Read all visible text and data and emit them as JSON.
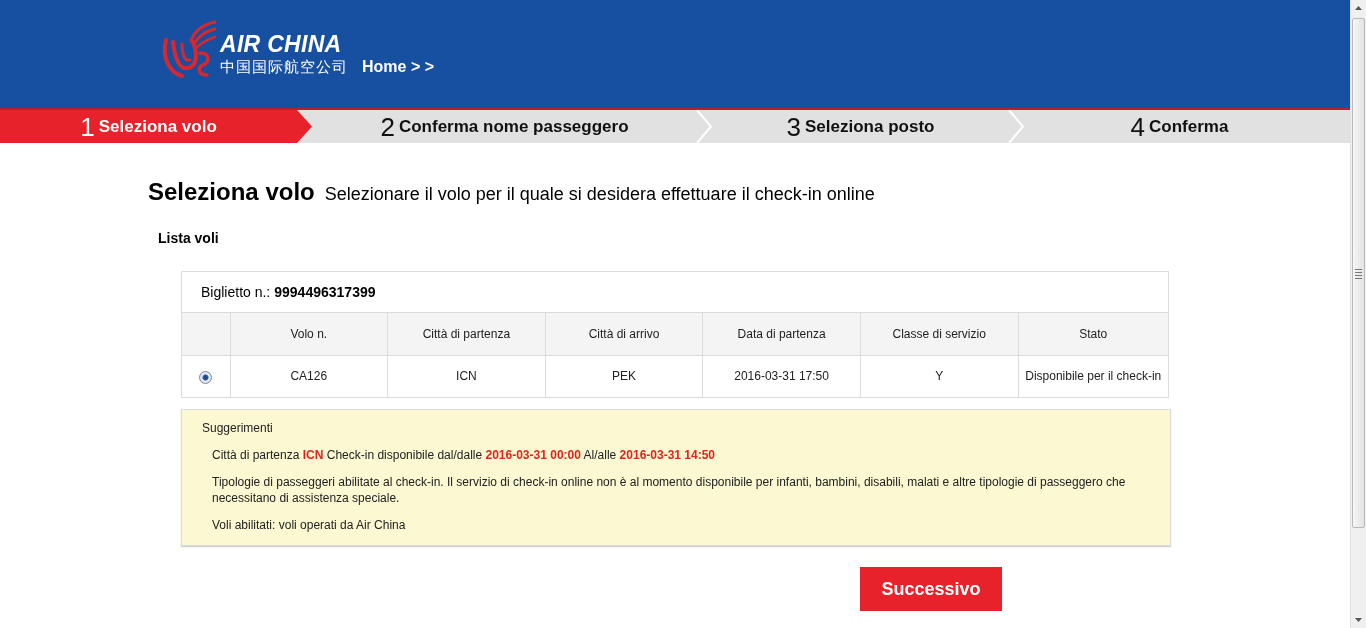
{
  "header": {
    "logo_text": "AIR CHINA",
    "logo_text_cn": "中国国际航空公司",
    "breadcrumb": "Home > >"
  },
  "steps": [
    {
      "number": "1",
      "label": "Seleziona volo",
      "selected": true
    },
    {
      "number": "2",
      "label": "Conferma nome passeggero",
      "selected": false
    },
    {
      "number": "3",
      "label": "Seleziona posto",
      "selected": false
    },
    {
      "number": "4",
      "label": "Conferma",
      "selected": false
    }
  ],
  "page": {
    "title": "Seleziona volo",
    "subtitle": "Selezionare il volo per il quale si desidera effettuare il check-in online"
  },
  "flight_list": {
    "heading": "Lista voli",
    "ticket_label": "Biglietto n.:",
    "ticket_number": "9994496317399",
    "columns": [
      "Volo n.",
      "Città di partenza",
      "Città di arrivo",
      "Data di partenza",
      "Classe di servizio",
      "Stato"
    ],
    "rows": [
      {
        "selected": true,
        "cells": [
          "CA126",
          "ICN",
          "PEK",
          "2016-03-31 17:50",
          "Y",
          "Disponibile per il check-in"
        ]
      }
    ]
  },
  "tips": {
    "title": "Suggerimenti",
    "items": [
      "Città di partenza **ICN** Check-in disponibile dal/dalle **2016-03-31 00:00** Al/alle **2016-03-31 14:50**",
      "Tipologie di passeggeri abilitate al check-in. Il servizio di check-in online non è al momento disponibile per infanti, bambini, disabili, malati e altre tipologie di passeggero che necessitano di assistenza speciale.",
      "Voli abilitati: voli operati da Air China"
    ]
  },
  "next_button": "Successivo"
}
